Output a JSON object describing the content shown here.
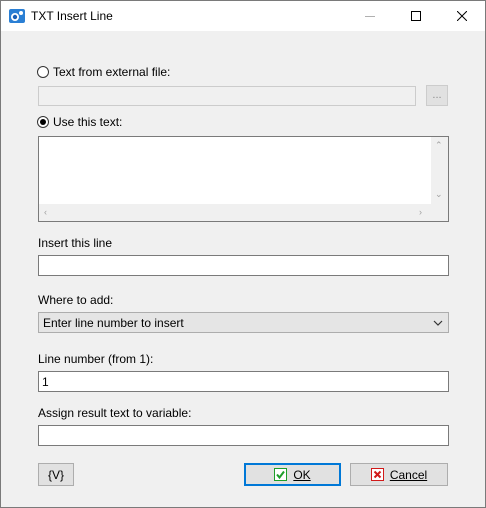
{
  "window": {
    "title": "TXT Insert Line",
    "accent_color": "#1a5fb4"
  },
  "source": {
    "external_file_label": "Text from external file:",
    "external_file_value": "",
    "browse_label": "...",
    "use_text_label": "Use this text:",
    "use_text_value": "",
    "selected": "use_text"
  },
  "insert_line": {
    "label": "Insert this line",
    "value": ""
  },
  "where_to_add": {
    "label": "Where to add:",
    "selected": "Enter line number to insert"
  },
  "line_number": {
    "label": "Line number (from 1):",
    "value": "1"
  },
  "assign_variable": {
    "label": "Assign result text  to variable:",
    "value": ""
  },
  "footer": {
    "variable_button": "{V}",
    "ok_button": "OK",
    "cancel_button": "Cancel",
    "ok_icon_color": "#1e9e2a",
    "cancel_icon_color": "#d11a1a"
  }
}
